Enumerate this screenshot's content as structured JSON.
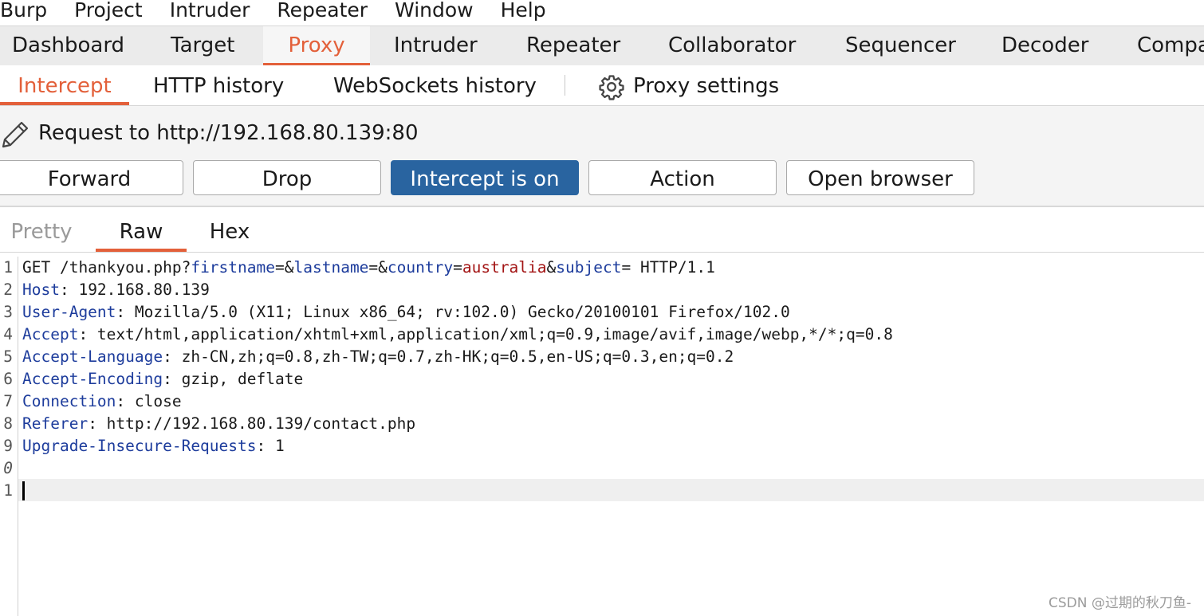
{
  "menu": [
    "Burp",
    "Project",
    "Intruder",
    "Repeater",
    "Window",
    "Help"
  ],
  "main_tabs": [
    "Dashboard",
    "Target",
    "Proxy",
    "Intruder",
    "Repeater",
    "Collaborator",
    "Sequencer",
    "Decoder",
    "Compa"
  ],
  "main_tab_active": "Proxy",
  "sub_tabs": [
    "Intercept",
    "HTTP history",
    "WebSockets history"
  ],
  "sub_tab_active": "Intercept",
  "proxy_settings_label": "Proxy settings",
  "icons": {
    "settings": "gear-icon",
    "edit": "pencil-icon"
  },
  "request_to": "Request to http://192.168.80.139:80",
  "buttons": {
    "forward": "Forward",
    "drop": "Drop",
    "intercept": "Intercept is on",
    "action": "Action",
    "open_browser": "Open browser"
  },
  "editor_tabs": [
    "Pretty",
    "Raw",
    "Hex"
  ],
  "editor_tab_active": "Raw",
  "line_numbers": [
    "1",
    "2",
    "3",
    "4",
    "5",
    "6",
    "7",
    "8",
    "9",
    "0",
    "1"
  ],
  "request": {
    "request_line": {
      "method_path": "GET /thankyou.php?",
      "params": [
        {
          "key": "firstname",
          "sep": "=",
          "value": "",
          "amp": "&"
        },
        {
          "key": "lastname",
          "sep": "=",
          "value": "",
          "amp": "&"
        },
        {
          "key": "country",
          "sep": "=",
          "value": "australia",
          "amp": "&"
        },
        {
          "key": "subject",
          "sep": "=",
          "value": "",
          "amp": ""
        }
      ],
      "version": " HTTP/1.1"
    },
    "headers": [
      {
        "name": "Host",
        "value": ": 192.168.80.139"
      },
      {
        "name": "User-Agent",
        "value": ": Mozilla/5.0 (X11; Linux x86_64; rv:102.0) Gecko/20100101 Firefox/102.0"
      },
      {
        "name": "Accept",
        "value": ": text/html,application/xhtml+xml,application/xml;q=0.9,image/avif,image/webp,*/*;q=0.8"
      },
      {
        "name": "Accept-Language",
        "value": ": zh-CN,zh;q=0.8,zh-TW;q=0.7,zh-HK;q=0.5,en-US;q=0.3,en;q=0.2"
      },
      {
        "name": "Accept-Encoding",
        "value": ": gzip, deflate"
      },
      {
        "name": "Connection",
        "value": ": close"
      },
      {
        "name": "Referer",
        "value": ": http://192.168.80.139/contact.php"
      },
      {
        "name": "Upgrade-Insecure-Requests",
        "value": ": 1"
      }
    ]
  },
  "colors": {
    "accent": "#e3603a",
    "intercept_on": "#2964a0",
    "header_key": "#1d3c9c",
    "param_value": "#a31515"
  },
  "watermark": "CSDN @过期的秋刀鱼-"
}
